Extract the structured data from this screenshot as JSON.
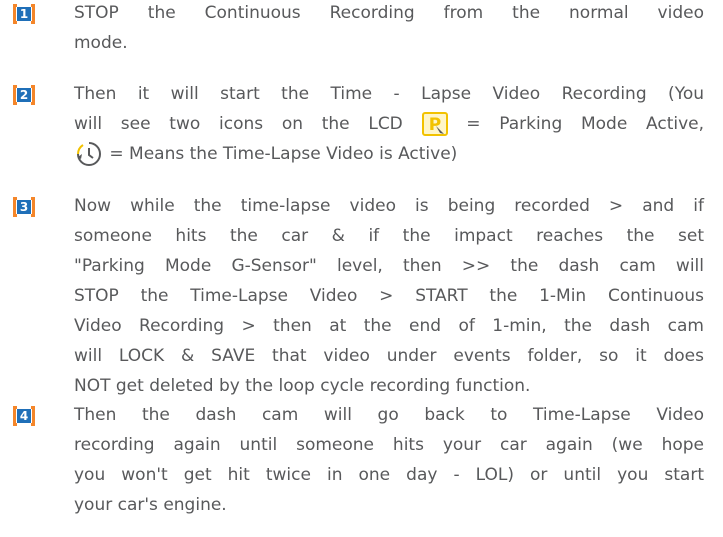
{
  "steps": [
    {
      "number": "1",
      "lines": [
        "STOP the Continuous Recording from the normal video",
        "mode."
      ]
    },
    {
      "number": "2",
      "line1": "Then it will  start  the Time - Lapse Video  Recording  (You",
      "line2_before": "will see two icons on the LCD",
      "line2_after": "=  Parking Mode Active,",
      "line3_after": "= Means the Time-Lapse Video is Active)",
      "parking_icon": "parking-mode-icon",
      "timelapse_icon": "timelapse-icon"
    },
    {
      "number": "3",
      "lines": [
        "Now while the time-lapse video is being recorded > and if",
        "someone hits the car & if the impact reaches the set",
        "\"Parking Mode G-Sensor\" level, then >> the dash cam will",
        "STOP the Time-Lapse Video > START the 1-Min Continuous",
        "Video Recording > then at the end of 1-min, the dash cam",
        "will LOCK & SAVE that video under events folder, so it does",
        "NOT get deleted by the loop cycle recording function."
      ]
    },
    {
      "number": "4",
      "lines": [
        "Then the dash cam will go back to Time-Lapse Video",
        "recording again until someone hits your car again (we hope",
        "you won't get hit twice in one day - LOL) or until you start",
        "your car's engine."
      ]
    }
  ],
  "colors": {
    "badge_bracket": "#f4862a",
    "badge_fill": "#1f6fb8",
    "text": "#58595b",
    "icon_yellow": "#f2c200"
  }
}
